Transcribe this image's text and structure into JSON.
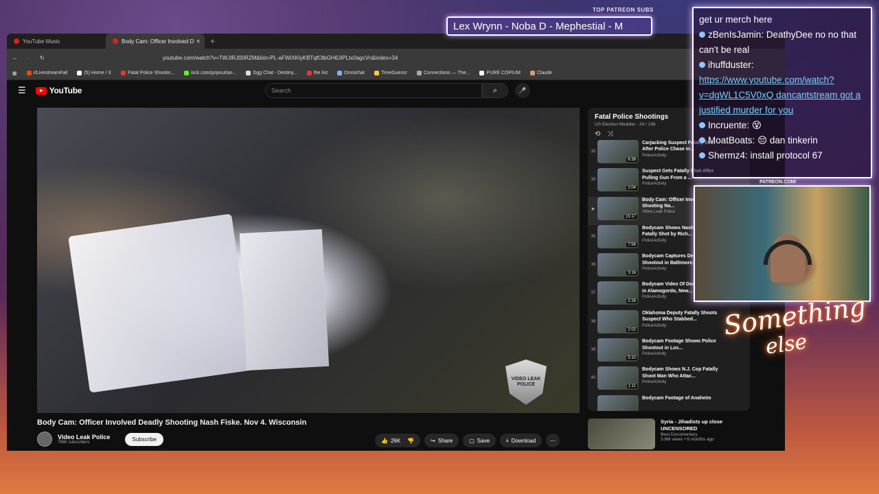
{
  "browser": {
    "tabs": [
      {
        "label": "YouTube Music"
      },
      {
        "label": "Body Cam: Officer Involved D"
      }
    ],
    "url": "youtube.com/watch?v=TWJIRJ00RZM&list=PL-aFWiXKlyKBTqfOlbGH6JIPLtx0agcVn&index=34",
    "bookmarks": [
      "r/LivestreamFail",
      "(5) Home / X",
      "Fatal Police Shootin...",
      "kick.com/popout/an...",
      "Dgg Chat - Destiny...",
      "the list",
      "Omnichat",
      "TimeGuessr",
      "Connections — The...",
      "PURE COPIUM",
      "Claude"
    ]
  },
  "youtube": {
    "logo": "YouTube",
    "search_placeholder": "Search",
    "video_title": "Body Cam: Officer Involved Deadly Shooting Nash Fiske. Nov 4. Wisconsin",
    "channel": "Video Leak Police",
    "subs": "786K subscribers",
    "subscribe": "Subscribe",
    "likes": "26K",
    "share": "Share",
    "save": "Save",
    "download": "Download",
    "watermark": "VIDEO LEAK POLICE"
  },
  "playlist": {
    "title": "Fatal Police Shootings",
    "subtitle": "US Election Meddler - 34 / 196",
    "items": [
      {
        "num": "32",
        "title": "Carjacking Suspect Fatally Shot After Police Chase in...",
        "channel": "PoliceActivity",
        "dur": "6:38"
      },
      {
        "num": "33",
        "title": "Suspect Gets Fatally Shot After Pulling Gun From a ...",
        "channel": "PoliceActivity",
        "dur": "2:04"
      },
      {
        "num": "▶",
        "title": "Body Cam: Officer Involved Deadly Shooting Na...",
        "channel": "Video Leak Police",
        "dur": "15:17"
      },
      {
        "num": "35",
        "title": "Bodycam Shows Nashville Man Fatally Shot by Rich...",
        "channel": "PoliceActivity",
        "dur": "7:56"
      },
      {
        "num": "36",
        "title": "Bodycam Captures Deadly Shootout in Baltimore...",
        "channel": "PoliceActivity",
        "dur": "3:16"
      },
      {
        "num": "37",
        "title": "Bodycam Video Of Deadly Shootout in Alamogordo, New...",
        "channel": "PoliceActivity",
        "dur": "2:26"
      },
      {
        "num": "38",
        "title": "Oklahoma Deputy Fatally Shoots Suspect Who Stabbed...",
        "channel": "PoliceActivity",
        "dur": "2:02"
      },
      {
        "num": "39",
        "title": "Bodycam Footage Shows Police Shootout in Los...",
        "channel": "PoliceActivity",
        "dur": "5:10"
      },
      {
        "num": "40",
        "title": "Bodycam Shows N.J. Cop Fatally Shoot Man Who Attac...",
        "channel": "PoliceActivity",
        "dur": "1:11"
      },
      {
        "num": "",
        "title": "Bodycam Footage of Anaheim",
        "channel": "",
        "dur": ""
      }
    ]
  },
  "recommended": {
    "title": "Syria - Jihadists up close UNCENSORED",
    "channel": "Best Documentary",
    "meta": "3.8M views • 6 months ago"
  },
  "stream": {
    "top_patreon": "TOP PATREON SUBS",
    "marquee": "Lex Wrynn -  Noba D - Mephestial - M",
    "patreon_cam": "PATREON.COM/",
    "neon_line1": "Something",
    "neon_line2": "else",
    "chat": [
      {
        "user": "",
        "text": "get ur merch here"
      },
      {
        "user": "zBenIsJamin:",
        "text": "DeathyDee no no that can't be real"
      },
      {
        "user": "ihuffduster:",
        "text": ""
      },
      {
        "user": "",
        "text": "https://www.youtube.com/watch?v=dgWL1C5V0xQ dancantstream got a justified murder for you"
      },
      {
        "user": "Incruente:",
        "text": ""
      },
      {
        "user": "MoatBoats:",
        "text": "dan tinkerin"
      },
      {
        "user": "Shermz4:",
        "text": "install protocol 67"
      }
    ]
  }
}
